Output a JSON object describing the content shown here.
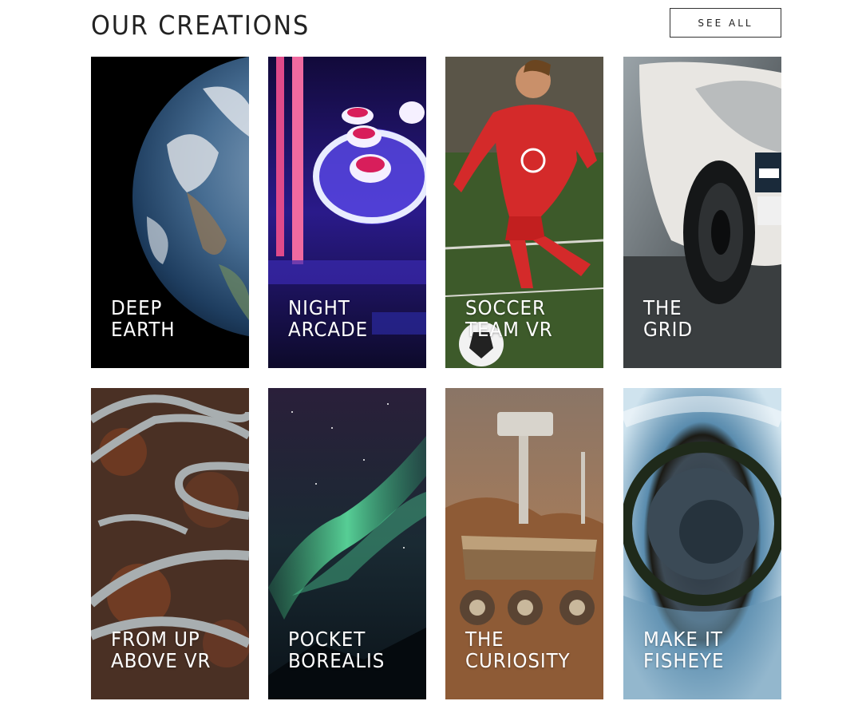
{
  "header": {
    "title": "OUR CREATIONS",
    "see_all_label": "SEE ALL"
  },
  "cards": [
    {
      "line1": "DEEP",
      "line2": "EARTH",
      "image": "earth-from-space"
    },
    {
      "line1": "NIGHT",
      "line2": "ARCADE",
      "image": "skee-ball-machine"
    },
    {
      "line1": "SOCCER",
      "line2": "TEAM VR",
      "image": "soccer-player"
    },
    {
      "line1": "THE",
      "line2": "GRID",
      "image": "race-car"
    },
    {
      "line1": "FROM UP",
      "line2": "ABOVE VR",
      "image": "winding-road-aerial"
    },
    {
      "line1": "POCKET",
      "line2": "BOREALIS",
      "image": "aurora-borealis"
    },
    {
      "line1": "THE",
      "line2": "CURIOSITY",
      "image": "mars-rover"
    },
    {
      "line1": "MAKE IT",
      "line2": "FISHEYE",
      "image": "fisheye-planet"
    }
  ]
}
